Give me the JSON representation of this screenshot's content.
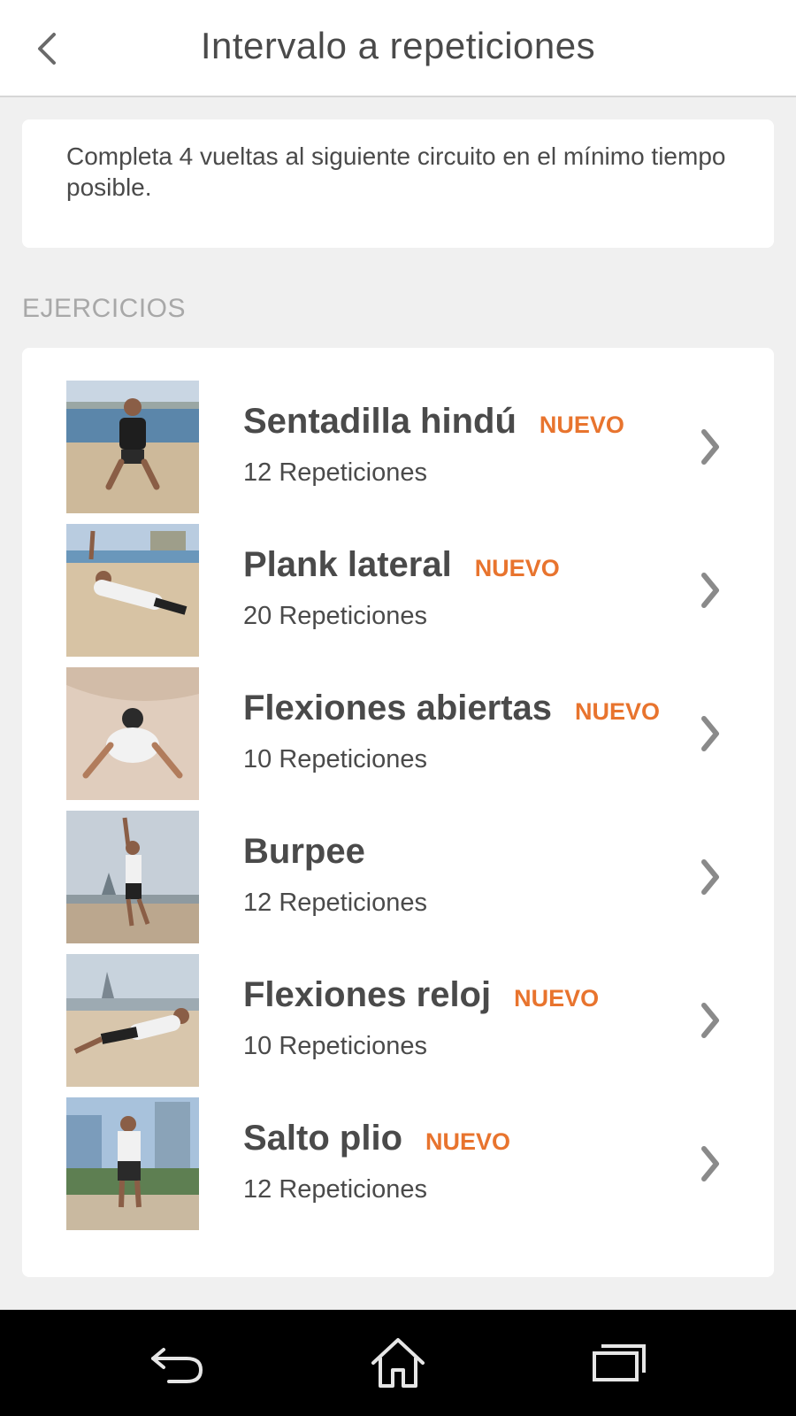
{
  "header": {
    "title": "Intervalo a repeticiones",
    "back_icon": "chevron-left-icon"
  },
  "description": {
    "text": "Completa 4 vueltas al siguiente circuito en el mínimo tiempo posible."
  },
  "section": {
    "label": "EJERCICIOS"
  },
  "exercises": [
    {
      "name": "Sentadilla hindú",
      "badge": "NUEVO",
      "reps": "12 Repeticiones"
    },
    {
      "name": "Plank lateral",
      "badge": "NUEVO",
      "reps": "20 Repeticiones"
    },
    {
      "name": "Flexiones abiertas",
      "badge": "NUEVO",
      "reps": "10 Repeticiones"
    },
    {
      "name": "Burpee",
      "badge": "",
      "reps": "12 Repeticiones"
    },
    {
      "name": "Flexiones reloj",
      "badge": "NUEVO",
      "reps": "10 Repeticiones"
    },
    {
      "name": "Salto plio",
      "badge": "NUEVO",
      "reps": "12 Repeticiones"
    }
  ],
  "nav": {
    "back_icon": "back-arrow-icon",
    "home_icon": "home-icon",
    "recents_icon": "recent-apps-icon"
  },
  "colors": {
    "accent": "#e8742e",
    "text": "#4a4a4a",
    "muted": "#a8a8a8",
    "background": "#f0f0f0"
  }
}
